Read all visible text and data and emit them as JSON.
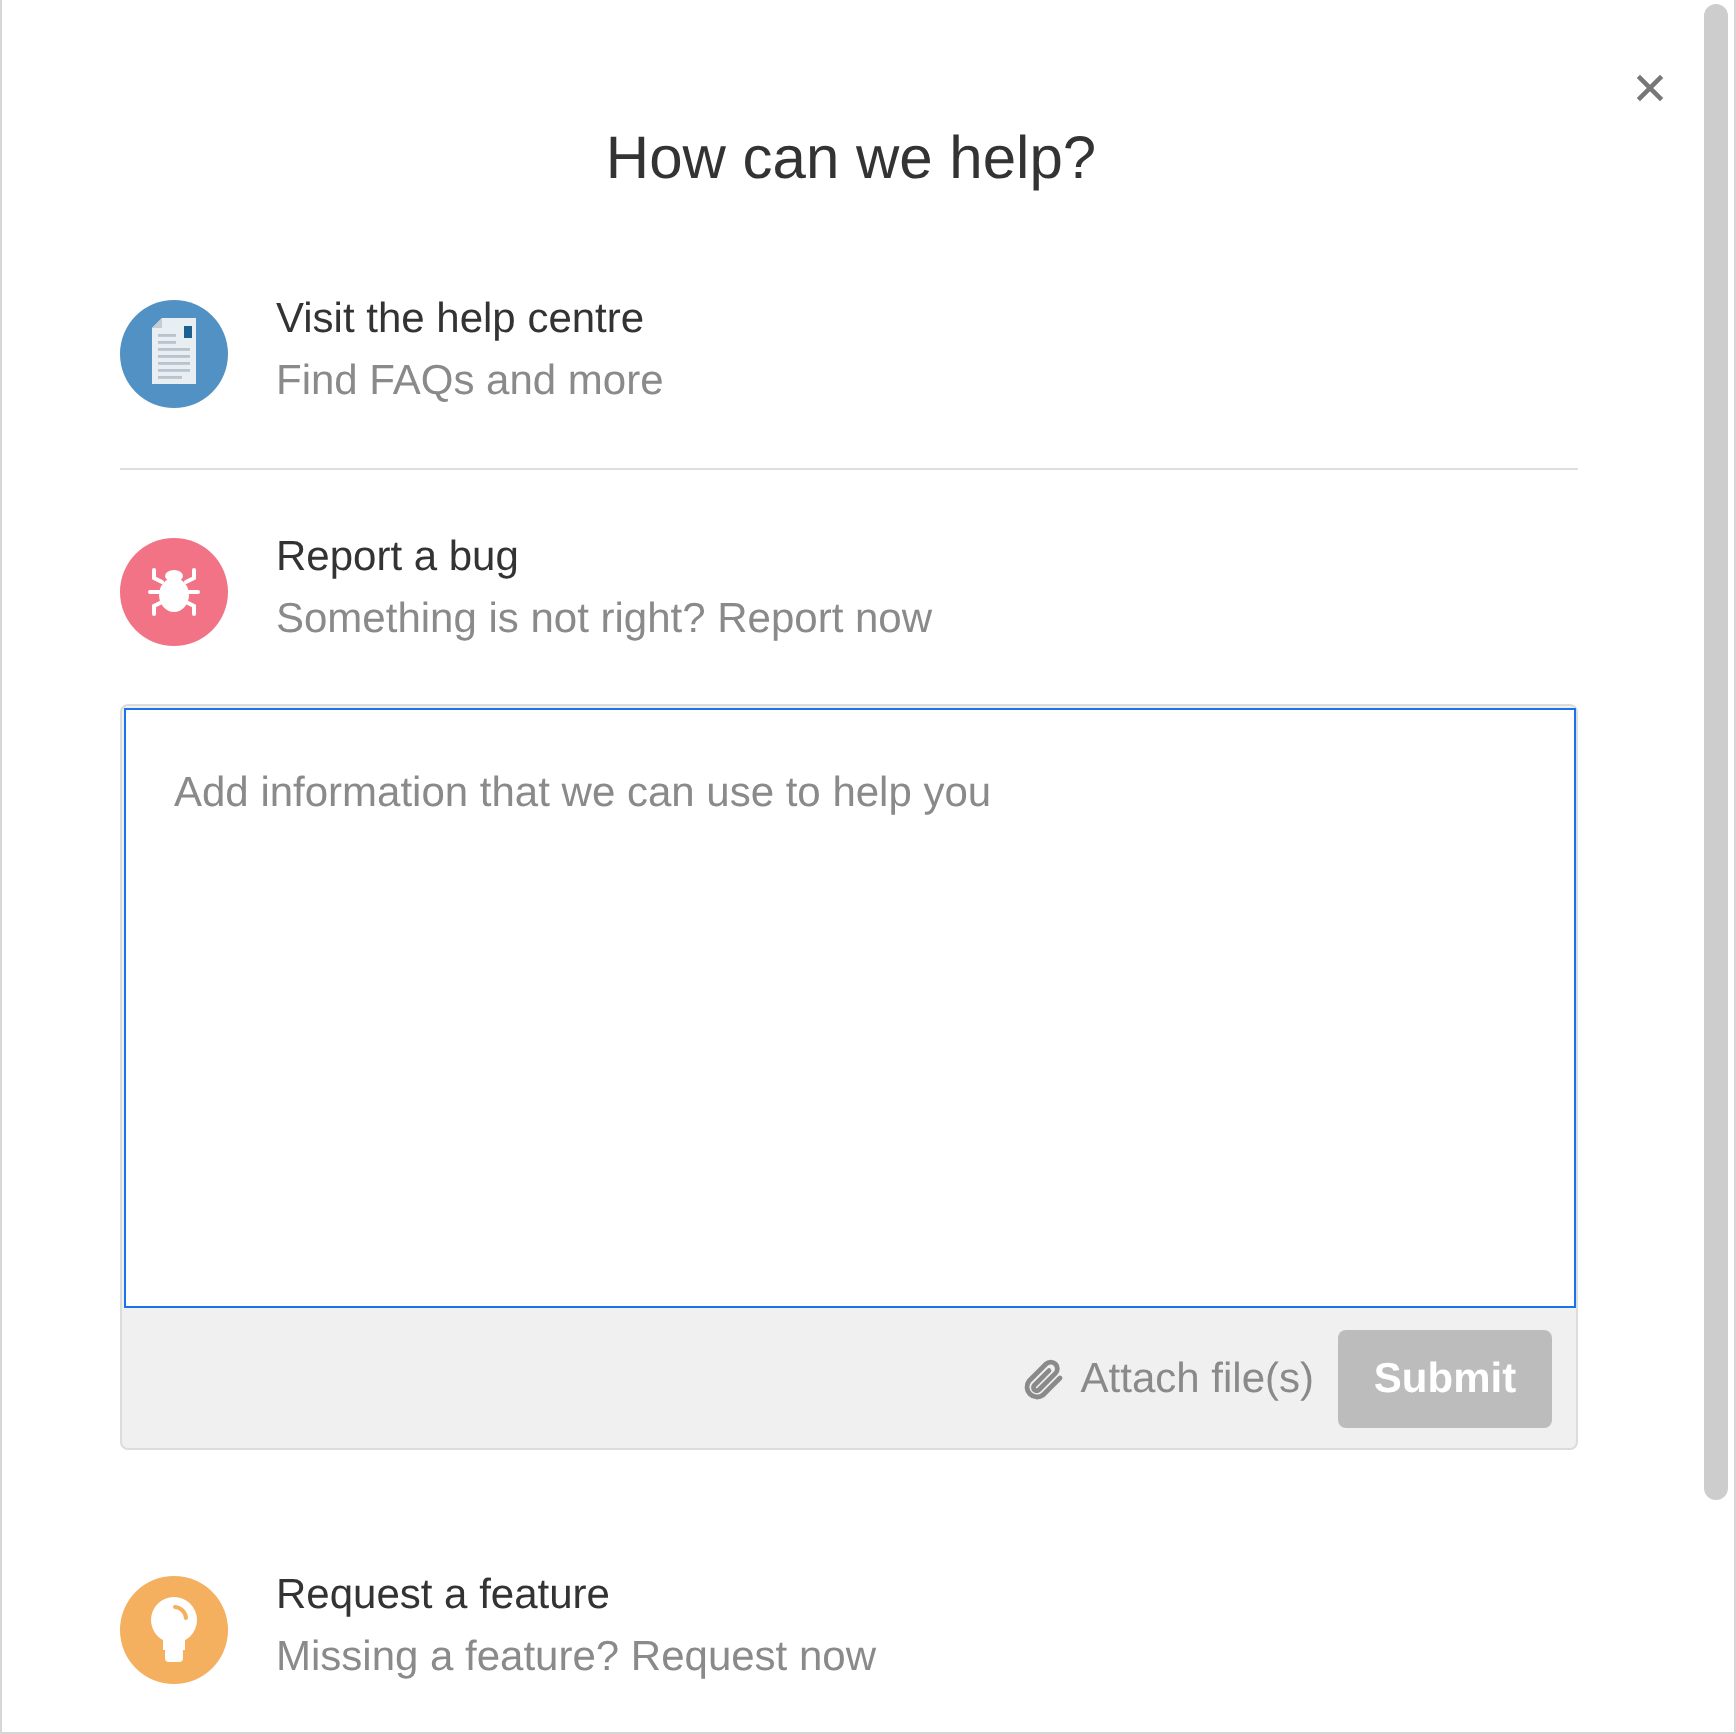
{
  "dialog": {
    "title": "How can we help?"
  },
  "options": [
    {
      "kind": "help",
      "color": "#5291c4",
      "title": "Visit the help centre",
      "subtitle": "Find FAQs and more"
    },
    {
      "kind": "bug",
      "color": "#f17385",
      "title": "Report a bug",
      "subtitle": "Something is not right? Report now",
      "form": {
        "placeholder": "Add information that we can use to help you",
        "focused": true,
        "attach_label": "Attach file(s)",
        "submit_label": "Submit",
        "submit_disabled": true
      }
    },
    {
      "kind": "feature",
      "color": "#f4af5f",
      "title": "Request a feature",
      "subtitle": "Missing a feature? Request now"
    }
  ]
}
